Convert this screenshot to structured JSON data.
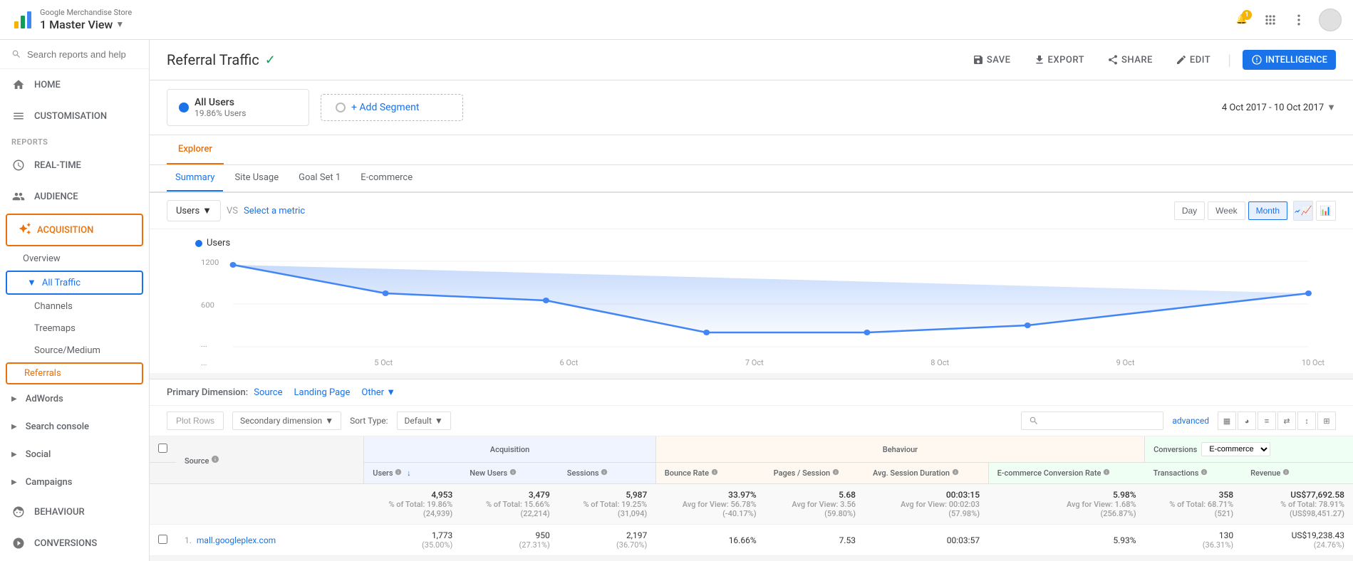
{
  "app": {
    "org": "Google Merchandise Store",
    "view": "1 Master View"
  },
  "header": {
    "notification_count": "1",
    "report_title": "Referral Traffic",
    "save_label": "SAVE",
    "export_label": "EXPORT",
    "share_label": "SHARE",
    "edit_label": "EDIT",
    "intelligence_label": "INTELLIGENCE"
  },
  "date_range": "4 Oct 2017 - 10 Oct 2017",
  "segments": {
    "all_users": {
      "name": "All Users",
      "sub": "19.86% Users"
    },
    "add_segment": "+ Add Segment"
  },
  "explorer": {
    "tab_label": "Explorer",
    "sub_tabs": [
      "Summary",
      "Site Usage",
      "Goal Set 1",
      "E-commerce"
    ]
  },
  "chart_controls": {
    "metric_dropdown": "Users",
    "vs_label": "VS",
    "select_metric": "Select a metric",
    "time_buttons": [
      "Day",
      "Week",
      "Month"
    ],
    "active_time": "Month",
    "legend_label": "Users"
  },
  "chart": {
    "y_labels": [
      "1200",
      "600"
    ],
    "x_labels": [
      "...",
      "5 Oct",
      "6 Oct",
      "7 Oct",
      "8 Oct",
      "9 Oct",
      "10 Oct"
    ]
  },
  "primary_dimension": {
    "label": "Primary Dimension:",
    "source": "Source",
    "landing_page": "Landing Page",
    "other": "Other"
  },
  "table_toolbar": {
    "plot_rows": "Plot Rows",
    "secondary_dimension": "Secondary dimension",
    "sort_type": "Sort Type:",
    "default": "Default",
    "search_placeholder": "",
    "advanced": "advanced"
  },
  "table": {
    "acquisition_header": "Acquisition",
    "behaviour_header": "Behaviour",
    "conversions_header": "Conversions",
    "ecommerce_option": "E-commerce",
    "columns": {
      "source": "Source",
      "users": "Users",
      "users_sort_icon": "↓",
      "new_users": "New Users",
      "sessions": "Sessions",
      "bounce_rate": "Bounce Rate",
      "pages_session": "Pages / Session",
      "avg_session": "Avg. Session Duration",
      "ecomm_rate": "E-commerce Conversion Rate",
      "transactions": "Transactions",
      "revenue": "Revenue"
    },
    "totals": {
      "users": "4,953",
      "users_pct": "% of Total: 19.86%",
      "users_abs": "(24,939)",
      "new_users": "3,479",
      "new_users_pct": "% of Total: 15.66%",
      "new_users_abs": "(22,214)",
      "sessions": "5,987",
      "sessions_pct": "% of Total: 19.25%",
      "sessions_abs": "(31,094)",
      "bounce_rate": "33.97%",
      "bounce_avg": "Avg for View: 56.78%",
      "bounce_diff": "(-40.17%)",
      "pages": "5.68",
      "pages_avg": "Avg for View: 3.56",
      "pages_diff": "(59.80%)",
      "avg_dur": "00:03:15",
      "avg_dur_avg": "Avg for View: 00:02:03",
      "avg_dur_diff": "(57.98%)",
      "ecomm_rate": "5.98%",
      "ecomm_avg": "Avg for View: 1.68%",
      "ecomm_diff": "(256.87%)",
      "transactions": "358",
      "transactions_pct": "% of Total: 68.71%",
      "transactions_abs": "(521)",
      "revenue": "US$77,692.58",
      "revenue_pct": "% of Total: 78.91%",
      "revenue_abs": "(US$98,451.27)"
    },
    "rows": [
      {
        "num": "1.",
        "source": "mall.googleplex.com",
        "users": "1,773",
        "users_pct": "(35.00%)",
        "new_users": "950",
        "new_users_pct": "(27.31%)",
        "sessions": "2,197",
        "sessions_pct": "(36.70%)",
        "bounce_rate": "16.66%",
        "pages": "7.53",
        "avg_dur": "00:03:57",
        "ecomm_rate": "5.93%",
        "transactions": "130",
        "transactions_pct": "(36.31%)",
        "revenue": "US$19,238.43",
        "revenue_pct": "(24.76%)"
      }
    ]
  },
  "sidebar": {
    "search_placeholder": "Search reports and help",
    "nav_items": [
      {
        "id": "home",
        "label": "HOME"
      },
      {
        "id": "customisation",
        "label": "CUSTOMISATION"
      }
    ],
    "reports_label": "Reports",
    "report_nav": [
      {
        "id": "realtime",
        "label": "REAL-TIME"
      },
      {
        "id": "audience",
        "label": "AUDIENCE"
      },
      {
        "id": "acquisition",
        "label": "ACQUISITION"
      }
    ],
    "acquisition_sub": [
      {
        "id": "overview",
        "label": "Overview"
      },
      {
        "id": "all-traffic",
        "label": "All Traffic",
        "expanded": true
      },
      {
        "id": "channels",
        "label": "Channels"
      },
      {
        "id": "treemaps",
        "label": "Treemaps"
      },
      {
        "id": "source-medium",
        "label": "Source/Medium"
      },
      {
        "id": "referrals",
        "label": "Referrals",
        "highlighted": true
      }
    ],
    "adwords_label": "AdWords",
    "search_console_label": "Search console",
    "social_label": "Social",
    "campaigns_label": "Campaigns",
    "behaviour_label": "BEHAVIOUR",
    "conversions_label": "CONVERSIONS"
  }
}
